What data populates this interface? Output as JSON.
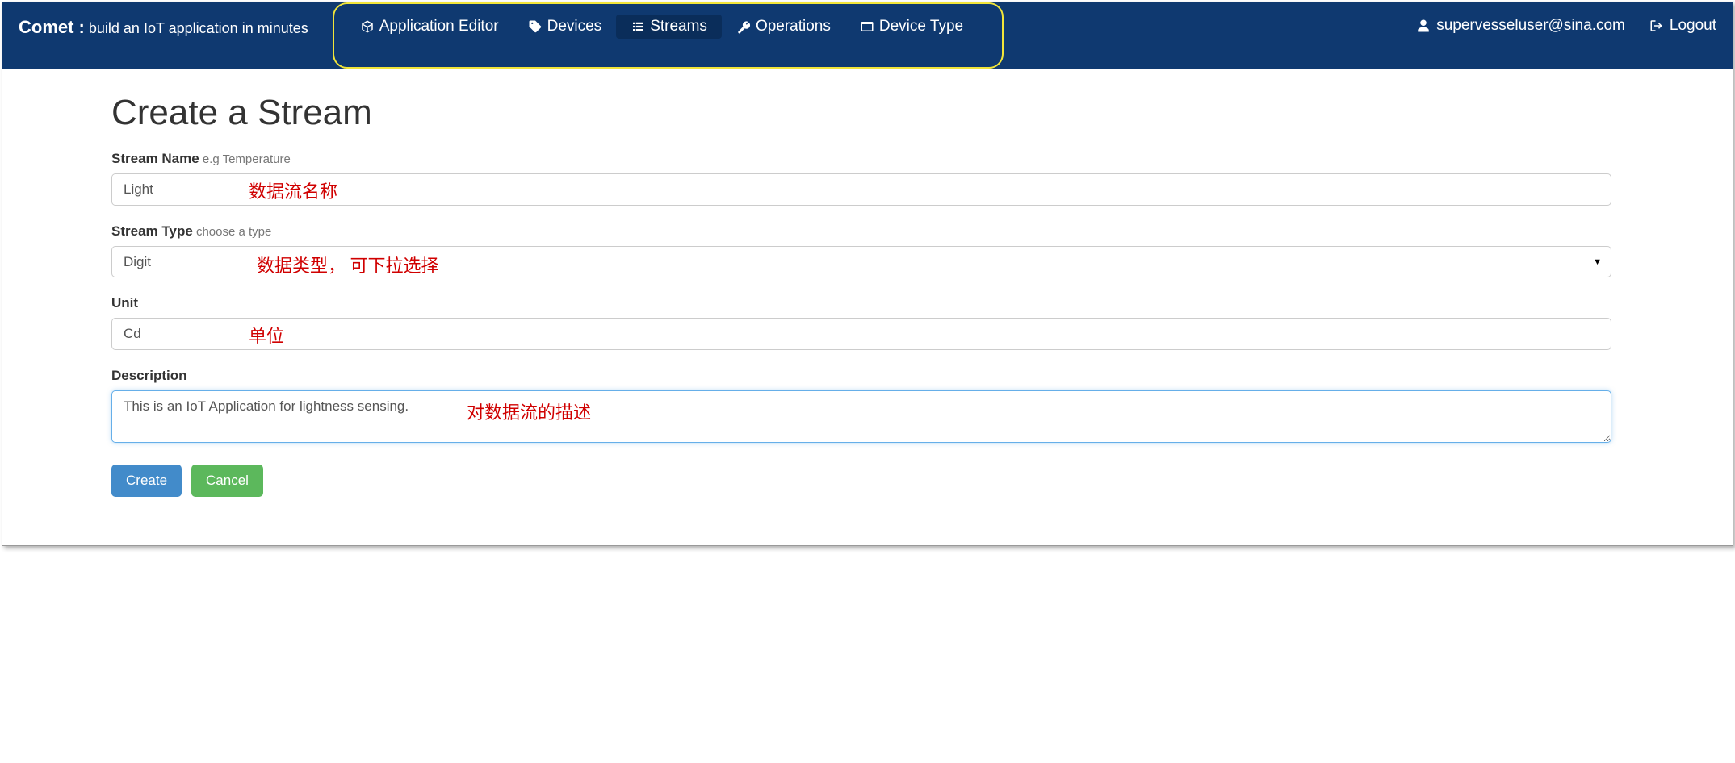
{
  "brand": {
    "name": "Comet :",
    "sub": " build an IoT application in minutes"
  },
  "nav": {
    "items": [
      {
        "label": "Application Editor",
        "icon": "cube"
      },
      {
        "label": "Devices",
        "icon": "tag"
      },
      {
        "label": "Streams",
        "icon": "list",
        "active": true
      },
      {
        "label": "Operations",
        "icon": "wrench"
      },
      {
        "label": "Device Type",
        "icon": "window"
      }
    ]
  },
  "user": {
    "email": "supervesseluser@sina.com",
    "logout": "Logout"
  },
  "page": {
    "title": "Create a Stream"
  },
  "form": {
    "streamName": {
      "label": "Stream Name",
      "hint": " e.g Temperature",
      "value": "Light"
    },
    "streamType": {
      "label": "Stream Type",
      "hint": " choose a type",
      "value": "Digit"
    },
    "unit": {
      "label": "Unit",
      "value": "Cd"
    },
    "description": {
      "label": "Description",
      "value": "This is an IoT Application for lightness sensing."
    }
  },
  "buttons": {
    "create": "Create",
    "cancel": "Cancel"
  },
  "annotations": {
    "streamName": "数据流名称",
    "streamType": "数据类型， 可下拉选择",
    "unit": "单位",
    "description": "对数据流的描述"
  }
}
